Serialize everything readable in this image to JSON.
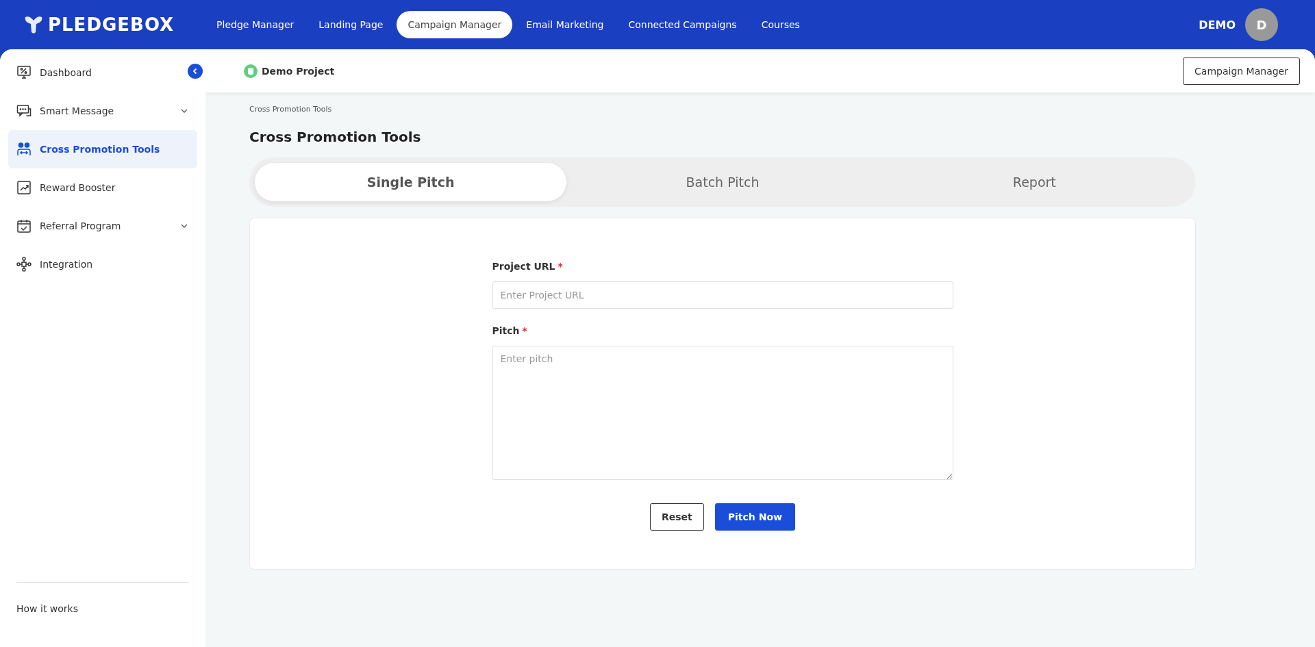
{
  "topbar": {
    "logo": "PLEDGEBOX",
    "nav": [
      {
        "label": "Pledge Manager",
        "selected": false
      },
      {
        "label": "Landing Page",
        "selected": false
      },
      {
        "label": "Campaign Manager",
        "selected": true
      },
      {
        "label": "Email Marketing",
        "selected": false
      },
      {
        "label": "Connected Campaigns",
        "selected": false
      },
      {
        "label": "Courses",
        "selected": false
      }
    ],
    "user": "DEMO",
    "avatar": "D"
  },
  "sidebar": {
    "items": [
      {
        "label": "Dashboard",
        "expandable": false,
        "selected": false
      },
      {
        "label": "Smart Message",
        "expandable": true,
        "selected": false
      },
      {
        "label": "Cross Promotion Tools",
        "expandable": false,
        "selected": true
      },
      {
        "label": "Reward Booster",
        "expandable": false,
        "selected": false
      },
      {
        "label": "Referral Program",
        "expandable": true,
        "selected": false
      },
      {
        "label": "Integration",
        "expandable": false,
        "selected": false
      }
    ],
    "footer_link": "How it works"
  },
  "header": {
    "project": "Demo Project",
    "button": "Campaign Manager"
  },
  "breadcrumb": "Cross Promotion Tools",
  "title": "Cross Promotion Tools",
  "tabs": [
    {
      "label": "Single Pitch",
      "selected": true
    },
    {
      "label": "Batch Pitch",
      "selected": false
    },
    {
      "label": "Report",
      "selected": false
    }
  ],
  "form": {
    "fields": [
      {
        "kind": "input",
        "label": "Project URL",
        "required_mark": "*",
        "placeholder": "Enter Project URL"
      },
      {
        "kind": "textarea",
        "label": "Pitch",
        "required_mark": "*",
        "placeholder": "Enter pitch"
      }
    ],
    "buttons": [
      {
        "label": "Reset",
        "kind": "secondary"
      },
      {
        "label": "Pitch Now",
        "kind": "primary"
      }
    ]
  }
}
